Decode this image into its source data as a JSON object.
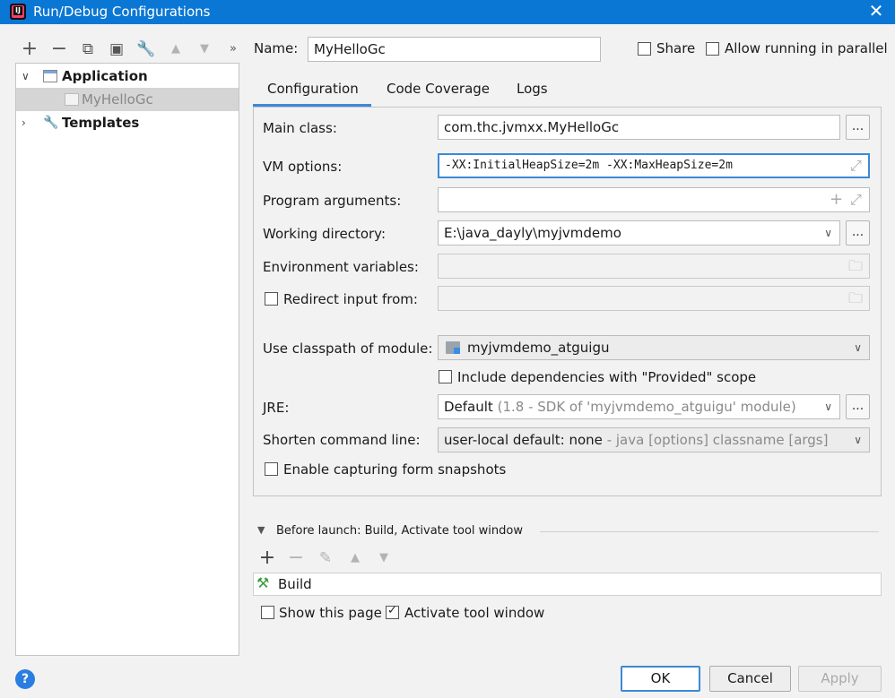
{
  "window": {
    "title": "Run/Debug Configurations"
  },
  "tree": {
    "application_label": "Application",
    "config_label": "MyHelloGc",
    "templates_label": "Templates"
  },
  "header": {
    "name_label": "Name:",
    "name_value": "MyHelloGc",
    "share_label": "Share",
    "parallel_label": "Allow running in parallel"
  },
  "tabs": [
    "Configuration",
    "Code Coverage",
    "Logs"
  ],
  "form": {
    "main_class_label": "Main class:",
    "main_class_value": "com.thc.jvmxx.MyHelloGc",
    "vm_options_label": "VM options:",
    "vm_options_value": "-XX:InitialHeapSize=2m -XX:MaxHeapSize=2m",
    "program_args_label": "Program arguments:",
    "program_args_value": "",
    "working_dir_label": "Working directory:",
    "working_dir_value": "E:\\java_dayly\\myjvmdemo",
    "env_vars_label": "Environment variables:",
    "redirect_label": "Redirect input from:",
    "classpath_label": "Use classpath of module:",
    "classpath_value": "myjvmdemo_atguigu",
    "include_deps_label": "Include dependencies with \"Provided\" scope",
    "jre_label": "JRE:",
    "jre_value": "Default",
    "jre_hint": "(1.8 - SDK of 'myjvmdemo_atguigu' module)",
    "shorten_label": "Shorten command line:",
    "shorten_value": "user-local default: none",
    "shorten_hint": "- java [options] classname [args]",
    "snapshots_label": "Enable capturing form snapshots",
    "browse_label": "..."
  },
  "before_launch": {
    "title": "Before launch: Build, Activate tool window",
    "item": "Build",
    "show_page_label": "Show this page",
    "activate_label": "Activate tool window",
    "activate_checked": true,
    "show_page_checked": false
  },
  "buttons": {
    "ok": "OK",
    "cancel": "Cancel",
    "apply": "Apply"
  },
  "colors": {
    "titlebar": "#0b77d4",
    "focus": "#3d89d6",
    "selection": "#d5d5d5"
  }
}
